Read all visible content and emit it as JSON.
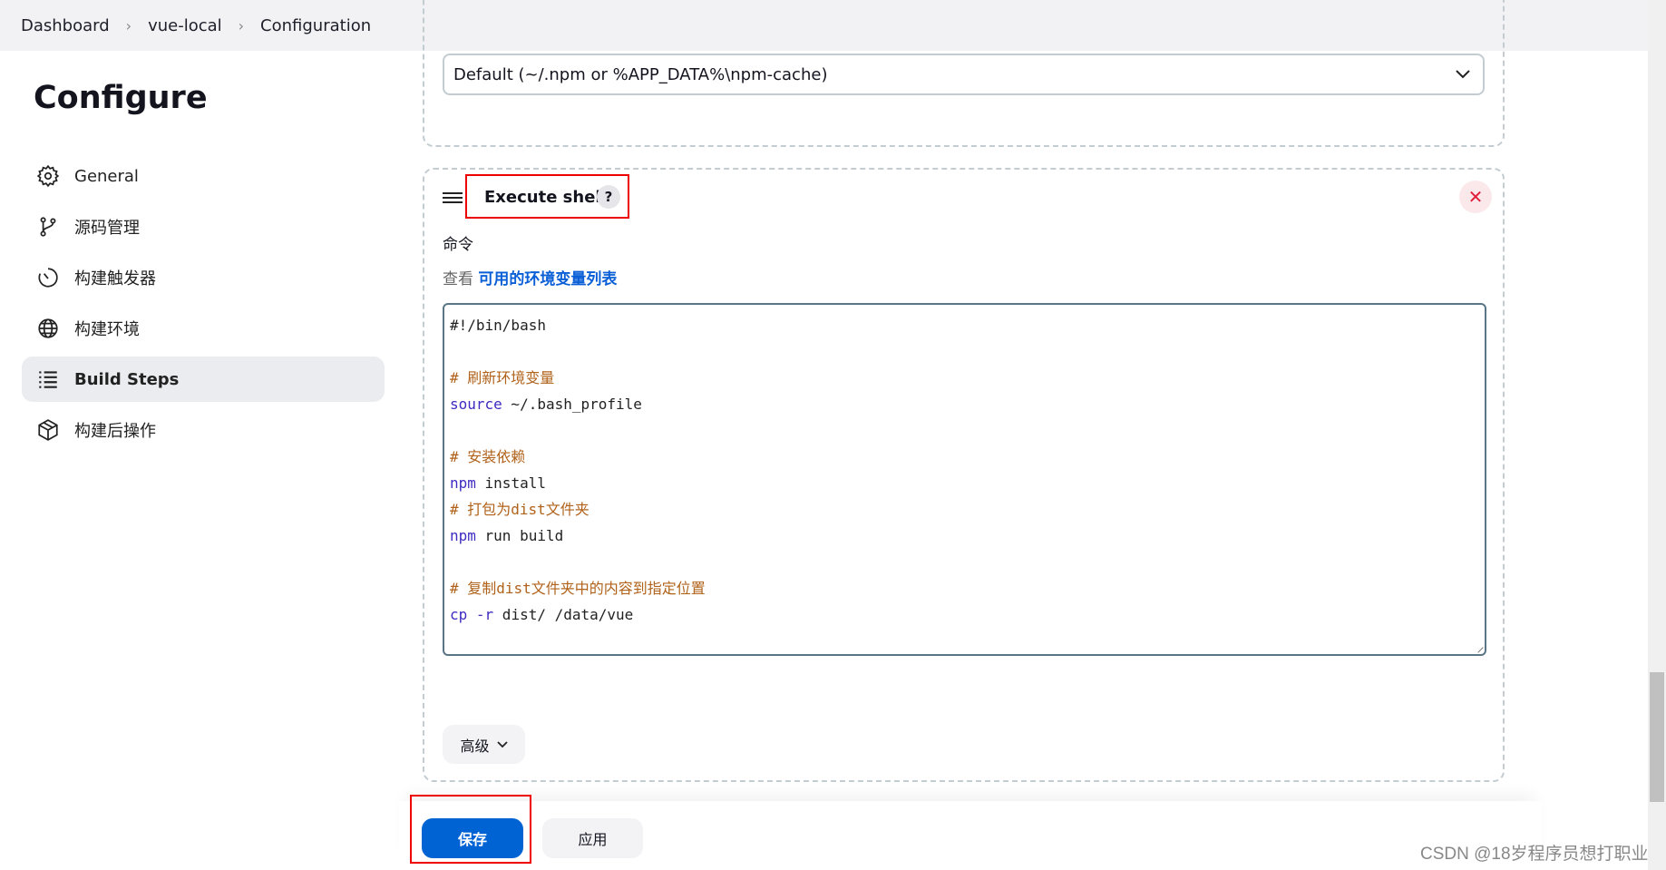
{
  "breadcrumb": [
    "Dashboard",
    "vue-local",
    "Configuration"
  ],
  "page_title": "Configure",
  "sidebar": {
    "items": [
      {
        "label": "General",
        "icon": "gear-icon"
      },
      {
        "label": "源码管理",
        "icon": "branch-icon"
      },
      {
        "label": "构建触发器",
        "icon": "timer-icon"
      },
      {
        "label": "构建环境",
        "icon": "globe-icon"
      },
      {
        "label": "Build Steps",
        "icon": "list-icon",
        "active": true
      },
      {
        "label": "构建后操作",
        "icon": "package-icon"
      }
    ]
  },
  "cache_select": {
    "value": "Default (~/.npm or %APP_DATA%\\npm-cache)"
  },
  "execute_shell": {
    "title": "Execute shell",
    "help": "?",
    "command_label": "命令",
    "env_prefix": "查看",
    "env_link": "可用的环境变量列表",
    "script_lines": [
      {
        "t": "#!/bin/bash",
        "cls": ""
      },
      {
        "t": "",
        "cls": ""
      },
      {
        "t": "# 刷新环境变量",
        "cls": "c"
      },
      {
        "kw": "source",
        "t": " ~/.bash_profile"
      },
      {
        "t": "",
        "cls": ""
      },
      {
        "t": "# 安装依赖",
        "cls": "c"
      },
      {
        "kw": "npm",
        "t": " install"
      },
      {
        "t": "# 打包为dist文件夹",
        "cls": "c"
      },
      {
        "kw": "npm",
        "t": " run build"
      },
      {
        "t": "",
        "cls": ""
      },
      {
        "t": "# 复制dist文件夹中的内容到指定位置",
        "cls": "c"
      },
      {
        "kw": "cp -r",
        "t": " dist/ /data/vue"
      }
    ],
    "advanced": "高级"
  },
  "buttons": {
    "save": "保存",
    "apply": "应用"
  },
  "watermark": "CSDN @18岁程序员想打职业",
  "colors": {
    "primary": "#0063d4",
    "highlight": "#ee0000",
    "comment": "#b0621a",
    "keyword": "#3d2bc2"
  }
}
